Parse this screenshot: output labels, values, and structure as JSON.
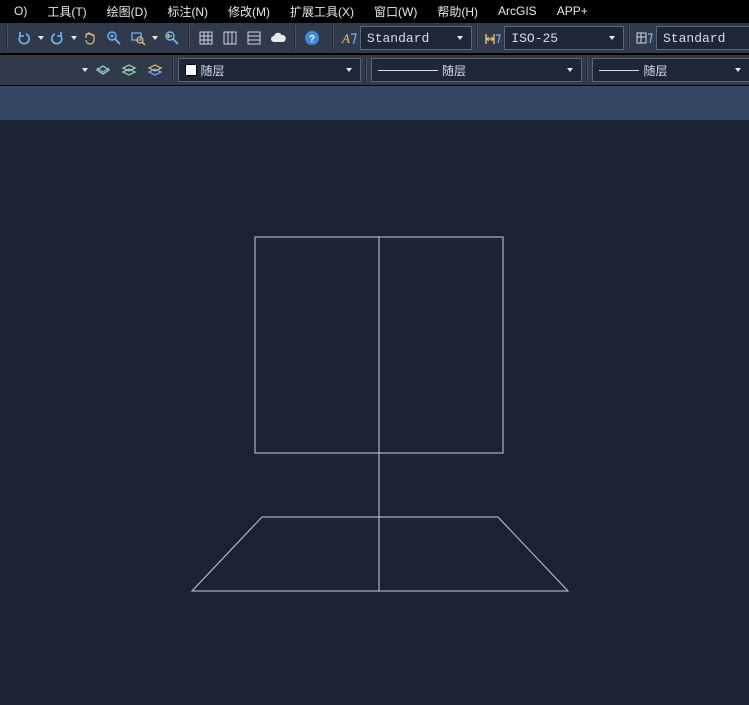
{
  "menus": {
    "o": "O)",
    "tool": "工具(T)",
    "draw": "绘图(D)",
    "annotate": "标注(N)",
    "modify": "修改(M)",
    "extend": "扩展工具(X)",
    "window": "窗口(W)",
    "help": "帮助(H)",
    "arcgis": "ArcGIS",
    "app": "APP+"
  },
  "styleCombos": {
    "textStyle": "Standard",
    "dimStyle": "ISO-25",
    "tableStyle": "Standard"
  },
  "propCombos": {
    "color": "随层",
    "linetype": "随层",
    "lineweight": "随层"
  }
}
